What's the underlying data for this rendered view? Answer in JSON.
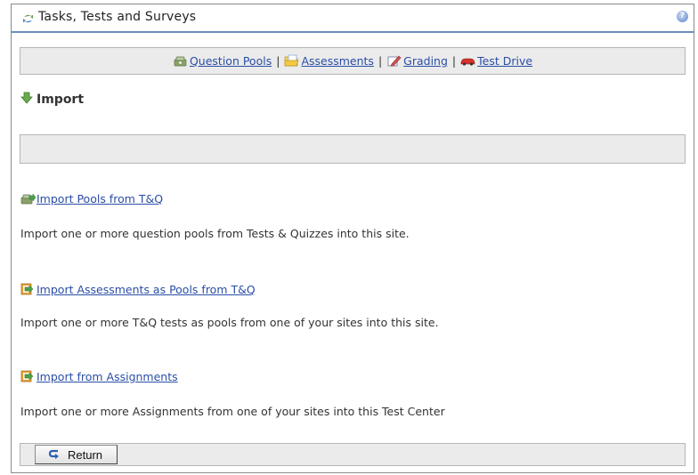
{
  "window": {
    "title": "Tasks, Tests and Surveys",
    "help_icon_text": "?"
  },
  "nav": {
    "items": [
      {
        "label": "Question Pools",
        "icon": "question-pools-icon"
      },
      {
        "label": "Assessments",
        "icon": "assessments-folder-icon"
      },
      {
        "label": "Grading",
        "icon": "grading-pencil-icon"
      },
      {
        "label": "Test Drive",
        "icon": "test-drive-car-icon"
      }
    ],
    "separator": "|"
  },
  "page": {
    "title": "Import",
    "title_icon": "import-arrow-icon"
  },
  "imports": [
    {
      "link": "Import Pools from T&Q",
      "description": "Import one or more question pools from Tests & Quizzes into this site.",
      "icon": "import-pools-icon"
    },
    {
      "link": "Import Assessments as Pools from T&Q",
      "description": "Import one or more T&Q tests as pools from one of your sites into this site.",
      "icon": "import-document-icon"
    },
    {
      "link": "Import from Assignments",
      "description": "Import one or more Assignments from one of your sites into this Test Center",
      "icon": "import-document-icon"
    }
  ],
  "footer": {
    "return_label": "Return",
    "return_icon": "return-arrow-icon"
  },
  "colors": {
    "link": "#2a4ea6",
    "bar_background": "#ebebeb",
    "title_underline": "#6a8fc0"
  }
}
